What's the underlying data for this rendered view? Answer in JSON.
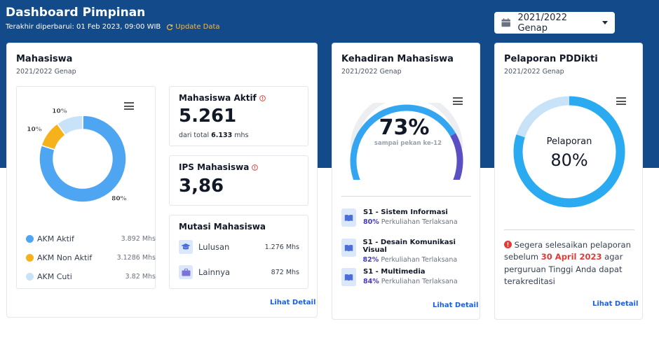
{
  "header": {
    "title": "Dashboard Pimpinan",
    "updated_label": "Terakhir diperbarui: 01 Feb 2023, 09:00 WIB",
    "update_link": "Update Data",
    "period": "2021/2022 Genap"
  },
  "mahasiswa": {
    "title": "Mahasiswa",
    "subtitle": "2021/2022 Genap",
    "chart_data": {
      "type": "pie",
      "categories": [
        "AKM Aktif",
        "AKM Non Aktif",
        "AKM Cuti"
      ],
      "values": [
        80,
        10,
        10
      ],
      "slice_labels": [
        "80%",
        "10%",
        "10%"
      ],
      "colors": [
        "#4ea5f2",
        "#f6b21a",
        "#c8e3f8"
      ]
    },
    "legend": [
      {
        "label": "AKM Aktif",
        "value": "3.892 Mhs"
      },
      {
        "label": "AKM Non Aktif",
        "value": "3.1286 Mhs"
      },
      {
        "label": "AKM Cuti",
        "value": "3.82 Mhs"
      }
    ],
    "aktif": {
      "label": "Mahasiswa Aktif",
      "value": "5.261",
      "total_prefix": "dari total",
      "total_value": "6.133",
      "total_suffix": "mhs"
    },
    "ips": {
      "label": "IPS Mahasiswa",
      "value": "3,86"
    },
    "mutasi": {
      "label": "Mutasi Mahasiswa",
      "rows": [
        {
          "label": "Lulusan",
          "value": "1.276 Mhs"
        },
        {
          "label": "Lainnya",
          "value": "872 Mhs"
        }
      ]
    },
    "detail_link": "Lihat Detail"
  },
  "kehadiran": {
    "title": "Kehadiran Mahasiswa",
    "subtitle": "2021/2022 Genap",
    "gauge": {
      "value": "73%",
      "caption": "sampai pekan ke-12",
      "fraction": 0.73
    },
    "programs": [
      {
        "name": "S1 - Sistem Informasi",
        "percent": "80%",
        "note": "Perkuliahan Terlaksana"
      },
      {
        "name": "S1 - Desain Komunikasi Visual",
        "percent": "82%",
        "note": "Perkuliahan Terlaksana"
      },
      {
        "name": "S1 - Multimedia",
        "percent": "84%",
        "note": "Perkuliahan Terlaksana"
      }
    ],
    "detail_link": "Lihat Detail"
  },
  "pddikti": {
    "title": "Pelaporan PDDikti",
    "subtitle": "2021/2022 Genap",
    "ring": {
      "label": "Pelaporan",
      "value": "80%",
      "fraction": 0.8
    },
    "warning": {
      "before": "Segera selesaikan pelaporan sebelum",
      "deadline": "30 April 2023",
      "after": "agar perguruan Tinggi Anda dapat terakreditasi"
    },
    "detail_link": "Lihat Detail"
  },
  "colors": {
    "brand": "#134b8a",
    "accent": "#f5b942",
    "link": "#1d5fd6",
    "primary": "#4ea5f2",
    "gauge_end": "#5b4fc4"
  }
}
